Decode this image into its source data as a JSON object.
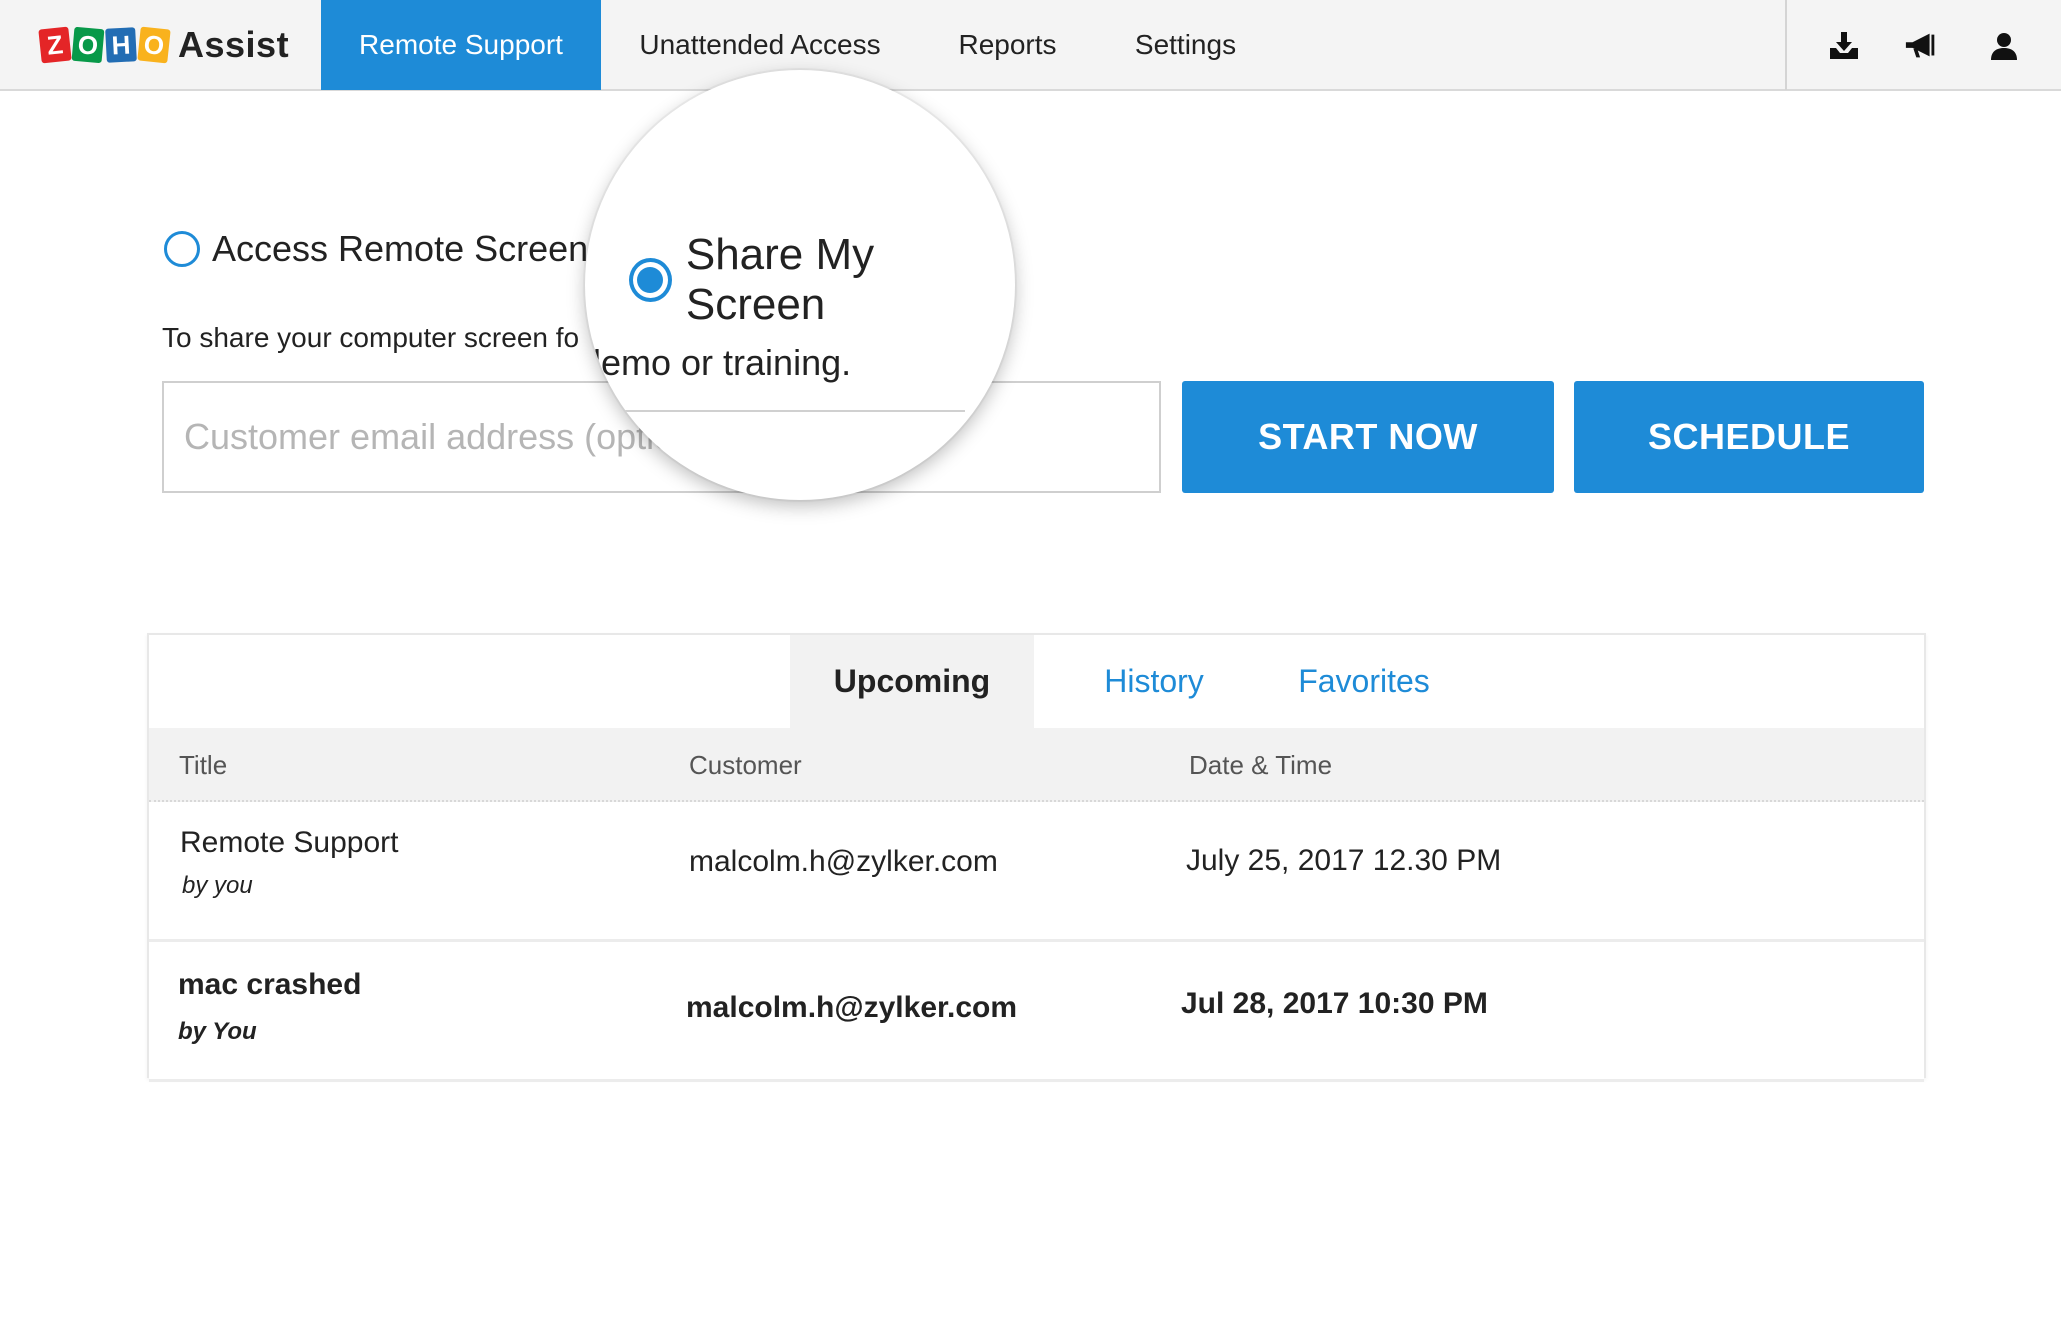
{
  "app": {
    "logo_letters": [
      "Z",
      "O",
      "H",
      "O"
    ],
    "logo_colors": [
      "#e42527",
      "#089949",
      "#226db4",
      "#f9b21d"
    ],
    "logo_word": "Assist",
    "accent_color": "#1e8bd7"
  },
  "nav": {
    "tabs": [
      {
        "label": "Remote Support",
        "active": true
      },
      {
        "label": "Unattended Access",
        "active": false
      },
      {
        "label": "Reports",
        "active": false
      },
      {
        "label": "Settings",
        "active": false
      }
    ],
    "icons": [
      "download-icon",
      "announcement-icon",
      "user-icon"
    ]
  },
  "session": {
    "options": [
      {
        "label": "Access Remote Screen",
        "selected": false
      },
      {
        "label": "Share My Screen",
        "selected": true
      }
    ],
    "description_visible": "To share your computer screen fo",
    "magnified_description": "lemo or training.",
    "email_placeholder": "Customer email address (optional)",
    "start_label": "START NOW",
    "schedule_label": "SCHEDULE"
  },
  "sessions_panel": {
    "tabs": [
      {
        "label": "Upcoming",
        "active": true
      },
      {
        "label": "History",
        "active": false
      },
      {
        "label": "Favorites",
        "active": false
      }
    ],
    "columns": [
      "Title",
      "Customer",
      "Date & Time"
    ],
    "rows": [
      {
        "title": "Remote Support",
        "by": "by you",
        "customer": "malcolm.h@zylker.com",
        "datetime": "July 25, 2017 12.30 PM",
        "bold": false
      },
      {
        "title": "mac crashed",
        "by": "by You",
        "customer": "malcolm.h@zylker.com",
        "datetime": "Jul 28, 2017 10:30 PM",
        "bold": true
      }
    ]
  }
}
